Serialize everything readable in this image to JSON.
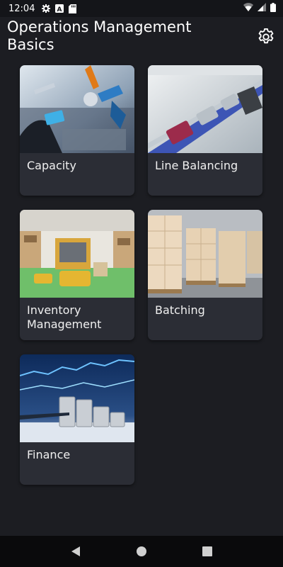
{
  "status_bar": {
    "time": "12:04",
    "icons": [
      "settings-icon",
      "keyboard-icon",
      "sd-card-icon"
    ],
    "right_icons": [
      "wifi-icon",
      "signal-icon",
      "battery-icon"
    ]
  },
  "app_bar": {
    "title": "Operations Management Basics",
    "settings_icon": "gear-icon"
  },
  "topics": [
    {
      "label": "Capacity",
      "image": "robotic-factory-photo"
    },
    {
      "label": "Line Balancing",
      "image": "conveyor-line-photo"
    },
    {
      "label": "Inventory Management",
      "image": "warehouse-agv-photo"
    },
    {
      "label": "Batching",
      "image": "boxes-on-pallets-photo"
    },
    {
      "label": "Finance",
      "image": "coins-and-chart-photo"
    }
  ],
  "nav_bar": {
    "buttons": [
      "back-icon",
      "home-icon",
      "recents-icon"
    ]
  },
  "colors": {
    "background": "#1c1d22",
    "card": "#2b2d35",
    "status_bar": "#141519",
    "nav_bar": "#0a0a0c"
  }
}
